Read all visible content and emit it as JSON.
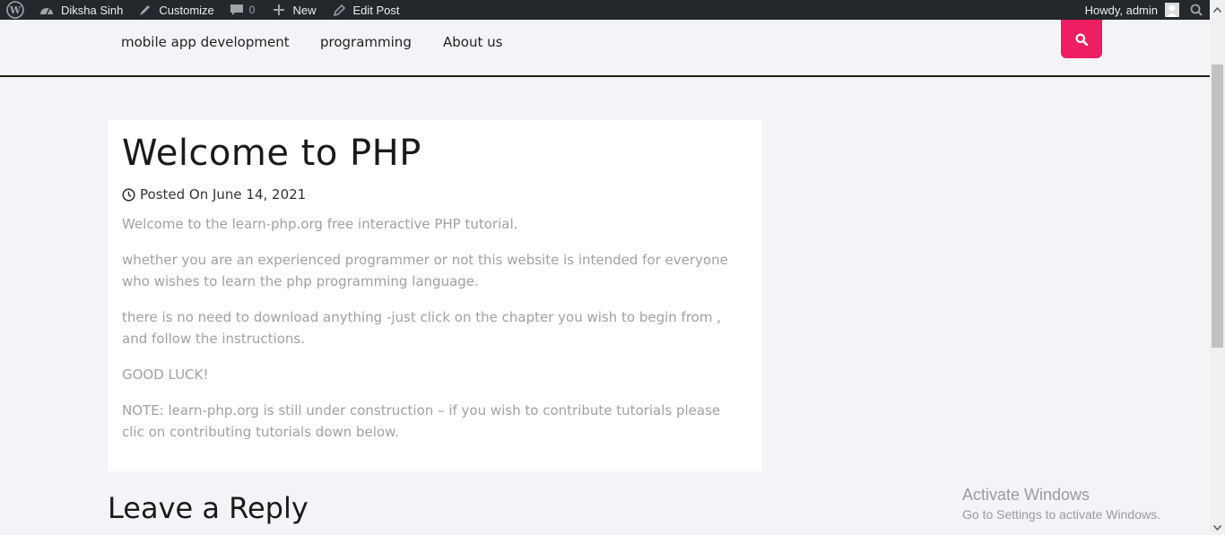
{
  "admin_bar": {
    "site_name": "Diksha Sinh",
    "customize": "Customize",
    "comments_count": "0",
    "new": "New",
    "edit_post": "Edit Post",
    "howdy": "Howdy, admin"
  },
  "nav": {
    "items": [
      "mobile app development",
      "programming",
      "About us"
    ]
  },
  "colors": {
    "accent": "#ee1e63",
    "admin_bar": "#23282d"
  },
  "post": {
    "title": "Welcome to PHP",
    "meta": "Posted On June 14, 2021",
    "paragraphs": [
      "Welcome to the learn-php.org free interactive PHP tutorial.",
      "whether you are an experienced programmer or not this website is intended for everyone who wishes to learn the php programming language.",
      "there is no need to download anything -just click on the chapter you wish to begin from , and follow the instructions.",
      "GOOD LUCK!",
      "NOTE: learn-php.org is still under construction – if you wish to contribute tutorials please clic on contributing tutorials down below."
    ]
  },
  "reply": {
    "title": "Leave a Reply"
  },
  "watermark": {
    "title": "Activate Windows",
    "subtitle": "Go to Settings to activate Windows."
  }
}
